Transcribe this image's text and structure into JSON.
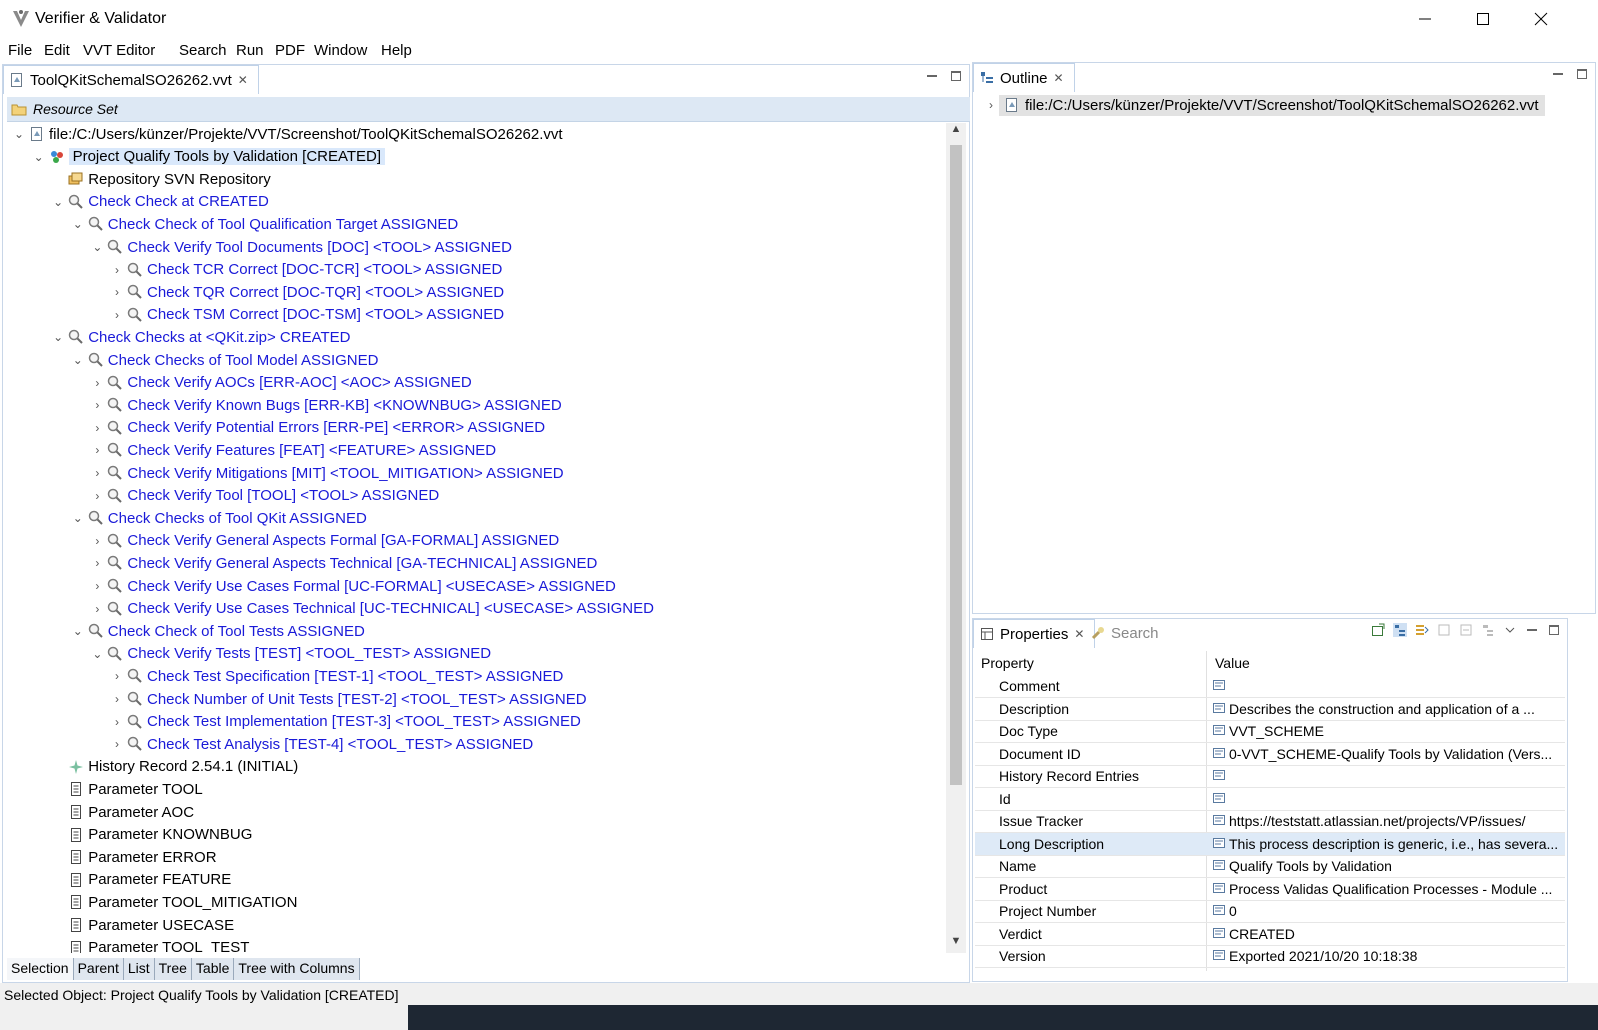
{
  "window": {
    "title": "Verifier & Validator"
  },
  "menu": [
    "File",
    "Edit",
    "VVT Editor",
    "Search",
    "Run",
    "PDF",
    "Window",
    "Help"
  ],
  "editor": {
    "tab_label": "ToolQKitSchemalSO26262.vvt",
    "resource_set_label": "Resource Set",
    "tree": [
      {
        "text": "file:/C:/Users/künzer/Projekte/VVT/Screenshot/ToolQKitSchemalSO26262.vvt",
        "icon": "file-icon"
      },
      {
        "text": "Project Qualify Tools by Validation [CREATED]",
        "icon": "project-icon"
      },
      {
        "text": "Repository SVN Repository",
        "icon": "repository-icon"
      },
      {
        "text": "Check Check at  CREATED",
        "icon": "check-icon"
      },
      {
        "text": "Check Check of Tool Qualification Target ASSIGNED",
        "icon": "check-icon"
      },
      {
        "text": "Check Verify Tool Documents [DOC] <TOOL> ASSIGNED",
        "icon": "check-icon"
      },
      {
        "text": "Check TCR Correct [DOC-TCR] <TOOL> ASSIGNED",
        "icon": "check-icon"
      },
      {
        "text": "Check TQR Correct [DOC-TQR] <TOOL> ASSIGNED",
        "icon": "check-icon"
      },
      {
        "text": "Check TSM Correct [DOC-TSM] <TOOL> ASSIGNED",
        "icon": "check-icon"
      },
      {
        "text": "Check Checks at <QKit.zip> CREATED",
        "icon": "check-icon"
      },
      {
        "text": "Check Checks of Tool Model ASSIGNED",
        "icon": "check-icon"
      },
      {
        "text": "Check Verify AOCs [ERR-AOC] <AOC> ASSIGNED",
        "icon": "check-icon"
      },
      {
        "text": "Check Verify Known Bugs [ERR-KB] <KNOWNBUG> ASSIGNED",
        "icon": "check-icon"
      },
      {
        "text": "Check Verify Potential Errors [ERR-PE] <ERROR> ASSIGNED",
        "icon": "check-icon"
      },
      {
        "text": "Check Verify Features [FEAT] <FEATURE> ASSIGNED",
        "icon": "check-icon"
      },
      {
        "text": "Check Verify Mitigations [MIT] <TOOL_MITIGATION> ASSIGNED",
        "icon": "check-icon"
      },
      {
        "text": "Check Verify Tool [TOOL] <TOOL> ASSIGNED",
        "icon": "check-icon"
      },
      {
        "text": "Check Checks of Tool QKit ASSIGNED",
        "icon": "check-icon"
      },
      {
        "text": "Check Verify General Aspects Formal [GA-FORMAL] ASSIGNED",
        "icon": "check-icon"
      },
      {
        "text": "Check Verify General Aspects Technical [GA-TECHNICAL] ASSIGNED",
        "icon": "check-icon"
      },
      {
        "text": "Check Verify Use Cases Formal [UC-FORMAL] <USECASE> ASSIGNED",
        "icon": "check-icon"
      },
      {
        "text": "Check Verify Use Cases Technical [UC-TECHNICAL] <USECASE> ASSIGNED",
        "icon": "check-icon"
      },
      {
        "text": "Check Check of Tool Tests ASSIGNED",
        "icon": "check-icon"
      },
      {
        "text": "Check Verify Tests [TEST] <TOOL_TEST> ASSIGNED",
        "icon": "check-icon"
      },
      {
        "text": "Check Test Specification [TEST-1] <TOOL_TEST> ASSIGNED",
        "icon": "check-icon"
      },
      {
        "text": "Check Number of Unit Tests [TEST-2] <TOOL_TEST> ASSIGNED",
        "icon": "check-icon"
      },
      {
        "text": "Check Test Implementation [TEST-3] <TOOL_TEST> ASSIGNED",
        "icon": "check-icon"
      },
      {
        "text": "Check Test Analysis [TEST-4] <TOOL_TEST> ASSIGNED",
        "icon": "check-icon"
      },
      {
        "text": "History Record 2.54.1 (INITIAL)",
        "icon": "history-icon"
      },
      {
        "text": "Parameter TOOL",
        "icon": "parameter-icon"
      },
      {
        "text": "Parameter AOC",
        "icon": "parameter-icon"
      },
      {
        "text": "Parameter KNOWNBUG",
        "icon": "parameter-icon"
      },
      {
        "text": "Parameter ERROR",
        "icon": "parameter-icon"
      },
      {
        "text": "Parameter FEATURE",
        "icon": "parameter-icon"
      },
      {
        "text": "Parameter TOOL_MITIGATION",
        "icon": "parameter-icon"
      },
      {
        "text": "Parameter USECASE",
        "icon": "parameter-icon"
      },
      {
        "text": "Parameter TOOL_TEST",
        "icon": "parameter-icon"
      }
    ],
    "bottom_tabs": [
      "Selection",
      "Parent",
      "List",
      "Tree",
      "Table",
      "Tree with Columns"
    ]
  },
  "outline": {
    "tab_label": "Outline",
    "root": "file:/C:/Users/künzer/Projekte/VVT/Screenshot/ToolQKitSchemalSO26262.vvt"
  },
  "properties": {
    "tab_label": "Properties",
    "search_tab_label": "Search",
    "col_property": "Property",
    "col_value": "Value",
    "rows": [
      {
        "name": "Comment",
        "value": ""
      },
      {
        "name": "Description",
        "value": "Describes the construction and application of a ..."
      },
      {
        "name": "Doc Type",
        "value": "VVT_SCHEME"
      },
      {
        "name": "Document ID",
        "value": "0-VVT_SCHEME-Qualify Tools by Validation (Vers..."
      },
      {
        "name": "History Record Entries",
        "value": ""
      },
      {
        "name": "Id",
        "value": ""
      },
      {
        "name": "Issue Tracker",
        "value": "https://teststatt.atlassian.net/projects/VP/issues/"
      },
      {
        "name": "Long Description",
        "value": "This process description is generic, i.e., has severa..."
      },
      {
        "name": "Name",
        "value": "Qualify Tools by Validation"
      },
      {
        "name": "Product",
        "value": "Process Validas Qualification Processes - Module ..."
      },
      {
        "name": "Project Number",
        "value": "0"
      },
      {
        "name": "Verdict",
        "value": "CREATED"
      },
      {
        "name": "Version",
        "value": "Exported 2021/10/20 10:18:38"
      }
    ]
  },
  "status": {
    "text": "Selected Object: Project Qualify Tools by Validation [CREATED]"
  },
  "colors": {
    "link_blue": "#1a1ad8",
    "selection_bg": "#d9e8fb",
    "header_bar": "#dde8f4"
  }
}
